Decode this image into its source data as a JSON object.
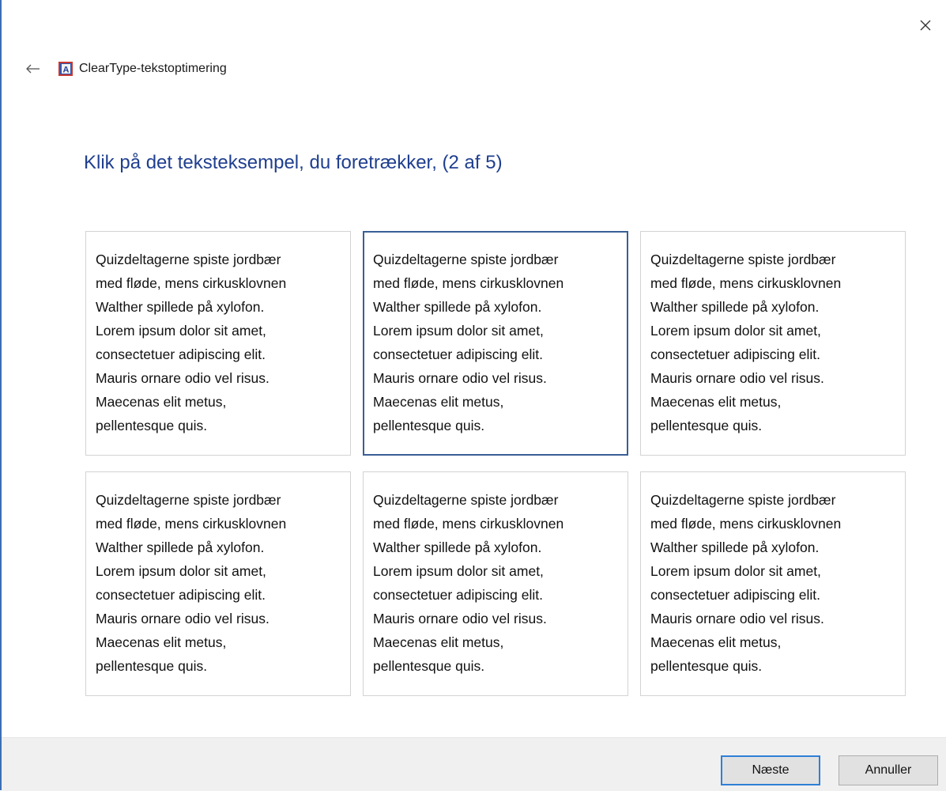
{
  "window": {
    "title": "ClearType-tekstoptimering",
    "accent_color": "#3c6fb4"
  },
  "titlebar": {
    "back_icon": "arrow-left-icon",
    "app_icon": "cleartype-icon",
    "close_icon": "close-icon"
  },
  "main": {
    "heading": "Klik på det teksteksempel, du foretrækker, (2 af 5)",
    "heading_color": "#1f3f8f",
    "samples": [
      {
        "text": "Quizdeltagerne spiste jordbær\nmed fløde, mens cirkusklovnen\nWalther spillede på xylofon.\nLorem ipsum dolor sit amet,\nconsectetuer adipiscing elit.\nMauris ornare odio vel risus.\nMaecenas elit metus,\npellentesque quis.",
        "selected": false
      },
      {
        "text": "Quizdeltagerne spiste jordbær\nmed fløde, mens cirkusklovnen\nWalther spillede på xylofon.\nLorem ipsum dolor sit amet,\nconsectetuer adipiscing elit.\nMauris ornare odio vel risus.\nMaecenas elit metus,\npellentesque quis.",
        "selected": true
      },
      {
        "text": "Quizdeltagerne spiste jordbær\nmed fløde, mens cirkusklovnen\nWalther spillede på xylofon.\nLorem ipsum dolor sit amet,\nconsectetuer adipiscing elit.\nMauris ornare odio vel risus.\nMaecenas elit metus,\npellentesque quis.",
        "selected": false
      },
      {
        "text": "Quizdeltagerne spiste jordbær\nmed fløde, mens cirkusklovnen\nWalther spillede på xylofon.\nLorem ipsum dolor sit amet,\nconsectetuer adipiscing elit.\nMauris ornare odio vel risus.\nMaecenas elit metus,\npellentesque quis.",
        "selected": false
      },
      {
        "text": "Quizdeltagerne spiste jordbær\nmed fløde, mens cirkusklovnen\nWalther spillede på xylofon.\nLorem ipsum dolor sit amet,\nconsectetuer adipiscing elit.\nMauris ornare odio vel risus.\nMaecenas elit metus,\npellentesque quis.",
        "selected": false
      },
      {
        "text": "Quizdeltagerne spiste jordbær\nmed fløde, mens cirkusklovnen\nWalther spillede på xylofon.\nLorem ipsum dolor sit amet,\nconsectetuer adipiscing elit.\nMauris ornare odio vel risus.\nMaecenas elit metus,\npellentesque quis.",
        "selected": false
      }
    ]
  },
  "footer": {
    "next_label": "Næste",
    "cancel_label": "Annuller"
  }
}
